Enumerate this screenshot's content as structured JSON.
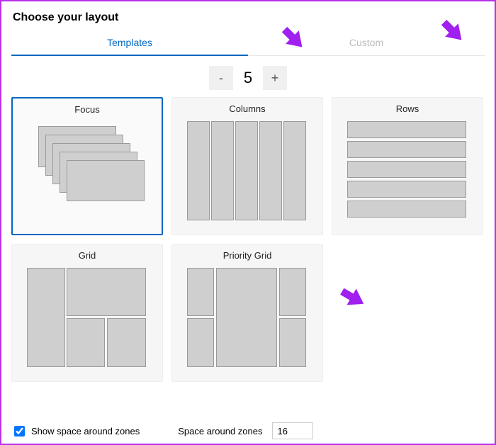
{
  "title": "Choose your layout",
  "tabs": {
    "templates": "Templates",
    "custom": "Custom"
  },
  "zone_count": "5",
  "stepper": {
    "minus": "-",
    "plus": "+"
  },
  "cards": {
    "focus": "Focus",
    "columns": "Columns",
    "rows": "Rows",
    "grid": "Grid",
    "priority_grid": "Priority Grid"
  },
  "footer": {
    "show_space": "Show space around zones",
    "space_label": "Space around zones",
    "space_value": "16"
  }
}
